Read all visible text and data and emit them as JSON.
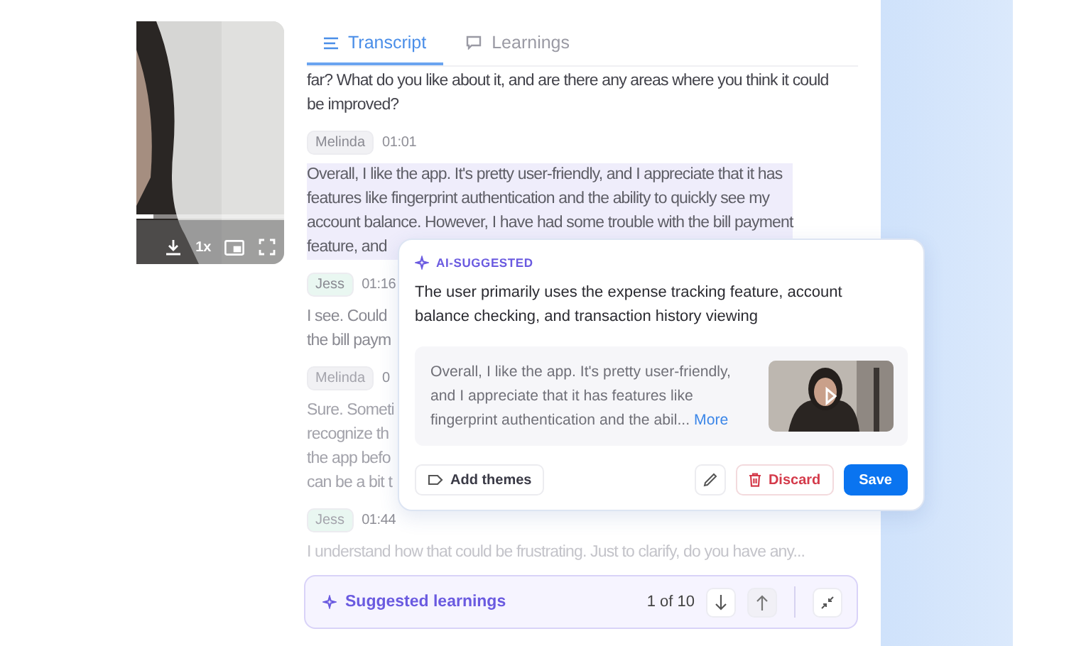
{
  "video": {
    "progress": {
      "level": 0.12
    },
    "speed": "1x"
  },
  "tabs": [
    {
      "label": "Transcript",
      "selected": true
    },
    {
      "label": "Learnings",
      "selected": false
    }
  ],
  "transcript": [
    {
      "kind": "text",
      "highlighted": false,
      "lines": [
        "far? What do you like about it, and are there any areas where you think it could",
        "be improved?"
      ]
    },
    {
      "kind": "message",
      "speaker": "Melinda",
      "color": "#f1f1f4",
      "time": "01:01",
      "highlighted": true,
      "lines": [
        "Overall, I like the app. It's pretty user-friendly, and I appreciate that it has",
        "features like fingerprint authentication and the ability to quickly see my",
        "account balance. However, I have had some trouble with the bill payment",
        "feature, and"
      ]
    },
    {
      "kind": "message",
      "speaker": "Jess",
      "color": "#e9f7f1",
      "time": "01:16",
      "highlighted": false,
      "lines": [
        "I see. Could",
        "the bill paym"
      ]
    },
    {
      "kind": "message",
      "speaker": "Melinda",
      "color": "#f1f1f4",
      "time": "0",
      "highlighted": false,
      "lines": [
        "Sure. Someti",
        "recognize th",
        "the app befo",
        "can be a bit t"
      ]
    },
    {
      "kind": "message",
      "speaker": "Jess",
      "color": "#e9f7f1",
      "time": "01:44",
      "highlighted": false,
      "lines": [
        "I understand how that could be frustrating. Just to clarify, do you have any..."
      ]
    }
  ],
  "suggestion": {
    "label": "AI-SUGGESTED",
    "summary": "The user primarily uses the expense tracking feature, account balance checking, and transaction history viewing",
    "quote_lines": [
      "Overall, I like the app. It's pretty user-friendly,",
      "and I appreciate that it has features like",
      "fingerprint authentication and the abil..."
    ],
    "more": "More",
    "add_themes": "Add themes",
    "discard": "Discard",
    "save": "Save"
  },
  "learnings_bar": {
    "title": "Suggested learnings",
    "counter": "1 of 10"
  }
}
